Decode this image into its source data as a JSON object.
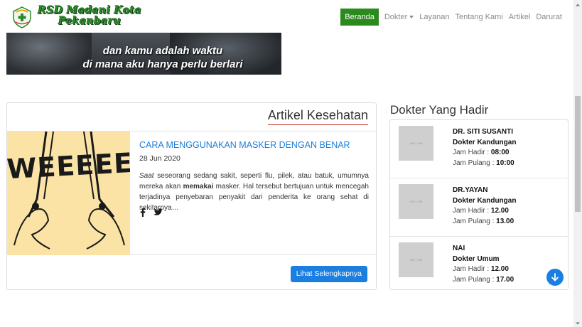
{
  "brand": {
    "line1": "RSD Madani Kota",
    "line2": "Pekanbaru"
  },
  "nav": {
    "items": [
      "Beranda",
      "Dokter",
      "Layanan",
      "Tentang Kami",
      "Artikel",
      "Darurat"
    ],
    "active": "Beranda"
  },
  "hero": {
    "caption_line1": "dan kamu adalah waktu",
    "caption_line2": "di mana aku hanya perlu berlari"
  },
  "articles": {
    "heading": "Artikel Kesehatan",
    "item": {
      "title": "CARA MENGGUNAKAN MASKER DENGAN BENAR",
      "date": "28 Jun 2020",
      "excerpt_em": "Saat",
      "excerpt_part1": " seseorang sedang sakit, seperti flu, pilek, atau batuk, umumnya mereka akan ",
      "excerpt_bold": "memakai",
      "excerpt_part2": " masker. Hal tersebut bertujuan untuk mencegah terjadinya penyebaran penyakit dari penderita ke orang sehat di sekitarnya…",
      "thumb_text": "WEEEEE"
    },
    "more_button": "Lihat Selengkapnya"
  },
  "doctors": {
    "heading": "Dokter Yang Hadir",
    "photo_placeholder": "100 x 100",
    "arrive_label": "Jam Hadir : ",
    "leave_label": "Jam Pulang : ",
    "list": [
      {
        "name": "DR. SITI SUSANTI",
        "specialty": "Dokter Kandungan",
        "arrive": "08:00",
        "leave": "10:00"
      },
      {
        "name": "DR.YAYAN",
        "specialty": "Dokter Kandungan",
        "arrive": "12.00",
        "leave": "13.00"
      },
      {
        "name": "NAI",
        "specialty": "Dokter Umum",
        "arrive": "12.00",
        "leave": "17.00"
      }
    ]
  },
  "colors": {
    "brand_green": "#2b8a1e",
    "link_blue": "#1a7fe0",
    "accent_red": "#c0392b"
  }
}
